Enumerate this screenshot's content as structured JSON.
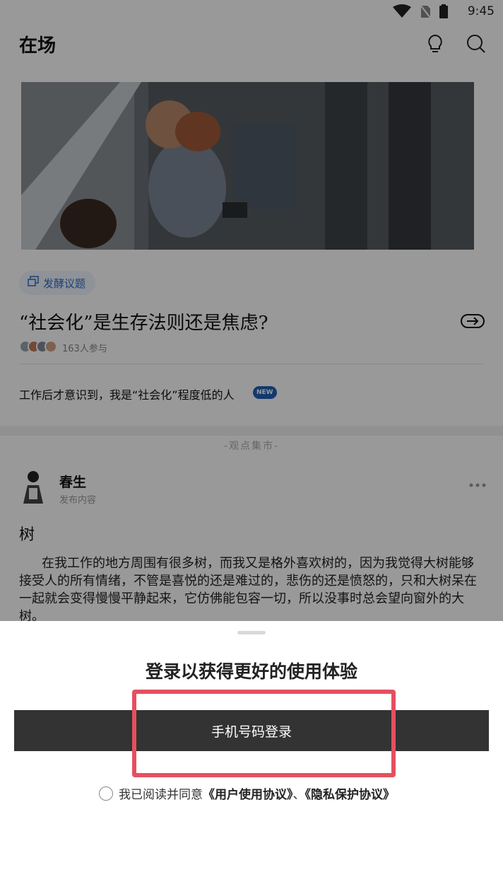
{
  "status_bar": {
    "time": "9:45",
    "icons": [
      "wifi-icon",
      "no-sim-icon",
      "battery-icon"
    ]
  },
  "app_bar": {
    "title": "在场",
    "icons": [
      "lightbulb-icon",
      "search-icon"
    ]
  },
  "feed": {
    "topic": {
      "tag_label": "发酵议题",
      "title": "“社会化”是生存法则还是焦虑?",
      "participants": "163人参与",
      "headline": "工作后才意识到，我是“社会化”程度低的人",
      "badge": "NEW"
    },
    "market_label": "-观点集市-",
    "post": {
      "author": "春生",
      "author_sub": "发布内容",
      "title": "树",
      "body": "在我工作的地方周围有很多树，而我又是格外喜欢树的，因为我觉得大树能够接受人的所有情绪，不管是喜悦的还是难过的，悲伤的还是愤怒的，只和大树呆在一起就会变得慢慢平静起来，它仿佛能包容一切，所以没事时总会望向窗外的大树。"
    }
  },
  "login_sheet": {
    "title": "登录以获得更好的使用体验",
    "phone_login_label": "手机号码登录",
    "agreement_prefix": "我已阅读并同意",
    "user_agreement": "《用户使用协议》",
    "separator": "、",
    "privacy_policy": "《隐私保护协议》"
  },
  "colors": {
    "accent_blue": "#2f6dc7",
    "button_dark": "#333333",
    "highlight_red": "#e4505e"
  }
}
